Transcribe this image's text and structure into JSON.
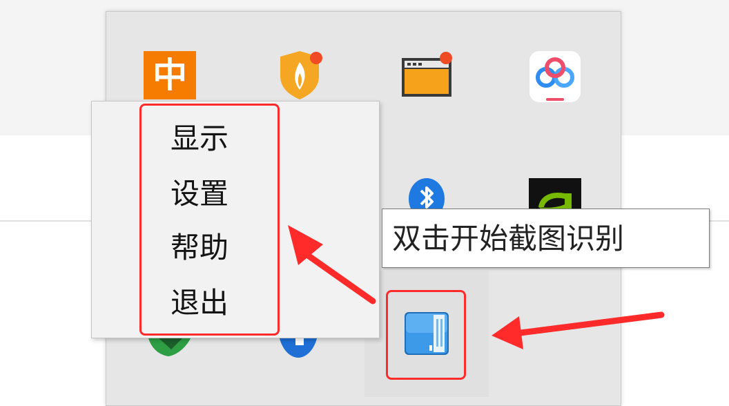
{
  "tray": {
    "icons": [
      {
        "name": "chinese-ime-icon",
        "glyph": "中",
        "color": "#f57c00"
      },
      {
        "name": "security-shield-icon",
        "color": "#f5a623",
        "badge": true
      },
      {
        "name": "window-app-icon",
        "color": "#f7a21b",
        "badge": true
      },
      {
        "name": "baidu-netdisk-icon",
        "color": "#2f8cf0"
      },
      {
        "name": "bluetooth-icon",
        "color": "#1e7ae0"
      },
      {
        "name": "nvidia-icon",
        "color": "#76b900"
      },
      {
        "name": "screenshot-ocr-app-icon",
        "color": "#2a86cf"
      }
    ]
  },
  "context_menu": {
    "items": [
      "显示",
      "设置",
      "帮助",
      "退出"
    ]
  },
  "tooltip": {
    "text": "双击开始截图识别"
  },
  "annotations": {
    "highlight_color": "#ff2b2b",
    "arrow_color": "#ff2b2b"
  }
}
